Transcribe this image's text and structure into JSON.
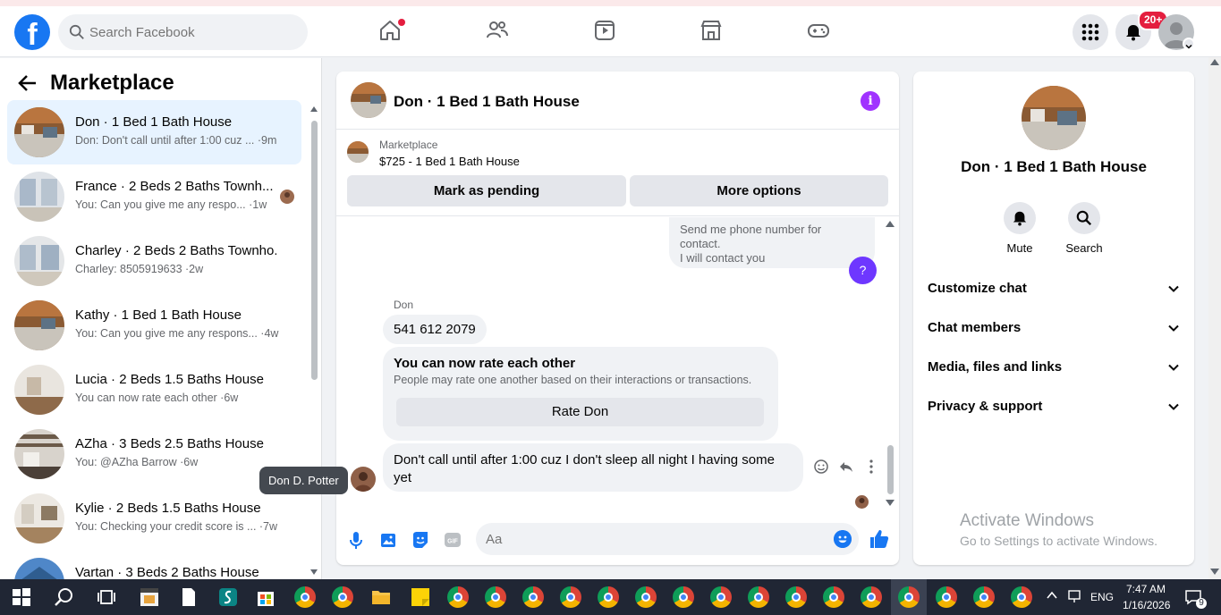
{
  "topbar": {
    "search_placeholder": "Search Facebook",
    "notification_badge": "20+",
    "logo_letter": "f"
  },
  "marketplace": {
    "title": "Marketplace",
    "conversations": [
      {
        "name": "Don · 1 Bed 1 Bath House",
        "preview": "Don: Don't call until after 1:00 cuz ... ·9m",
        "active": true
      },
      {
        "name": "France · 2 Beds 2 Baths Townh...",
        "preview": "You: Can you give me any respo... ·1w",
        "active": false
      },
      {
        "name": "Charley · 2 Beds 2 Baths Townho...",
        "preview": "Charley: 8505919633 ·2w",
        "active": false
      },
      {
        "name": "Kathy · 1 Bed 1 Bath House",
        "preview": "You: Can you give me any respons... ·4w",
        "active": false
      },
      {
        "name": "Lucia · 2 Beds 1.5 Baths House",
        "preview": "You can now rate each other ·6w",
        "active": false
      },
      {
        "name": "AZha · 3 Beds 2.5 Baths House",
        "preview": "You: @AZha Barrow ·6w",
        "active": false
      },
      {
        "name": "Kylie · 2 Beds 1.5 Baths House",
        "preview": "You: Checking your credit score is ... ·7w",
        "active": false
      },
      {
        "name": "Vartan · 3 Beds 2 Baths House",
        "preview": "",
        "active": false
      }
    ]
  },
  "chat": {
    "title": "Don · 1 Bed 1 Bath House",
    "info_icon": "i",
    "marketplace_label": "Marketplace",
    "listing": "$725 - 1 Bed 1 Bath House",
    "mark_pending": "Mark as pending",
    "more_options": "More options",
    "outgoing_message": "Send me phone number for contact.\n I will contact you",
    "question_mark": "?",
    "sender": "Don",
    "phone_message": "541 612 2079",
    "rate_title": "You can now rate each other",
    "rate_desc": "People may rate one another based on their interactions or transactions.",
    "rate_button": "Rate Don",
    "last_message": "Don't call until after 1:00 cuz I don't sleep all night I having some yet",
    "tooltip": "Don D. Potter",
    "composer_placeholder": "Aa",
    "gif_label": "GIF"
  },
  "details": {
    "name": "Don · 1 Bed 1 Bath House",
    "mute": "Mute",
    "search": "Search",
    "sections": [
      "Customize chat",
      "Chat members",
      "Media, files and links",
      "Privacy & support"
    ]
  },
  "watermark": {
    "line1": "Activate Windows",
    "line2": "Go to Settings to activate Windows."
  },
  "taskbar": {
    "lang": "ENG",
    "time": "7:47 AM",
    "date": "1/16/2026",
    "notif_count": "9"
  },
  "colors": {
    "brand": "#1877f2",
    "active_row": "#e7f3ff",
    "badge": "#e41e3f",
    "info": "#a033ff"
  }
}
